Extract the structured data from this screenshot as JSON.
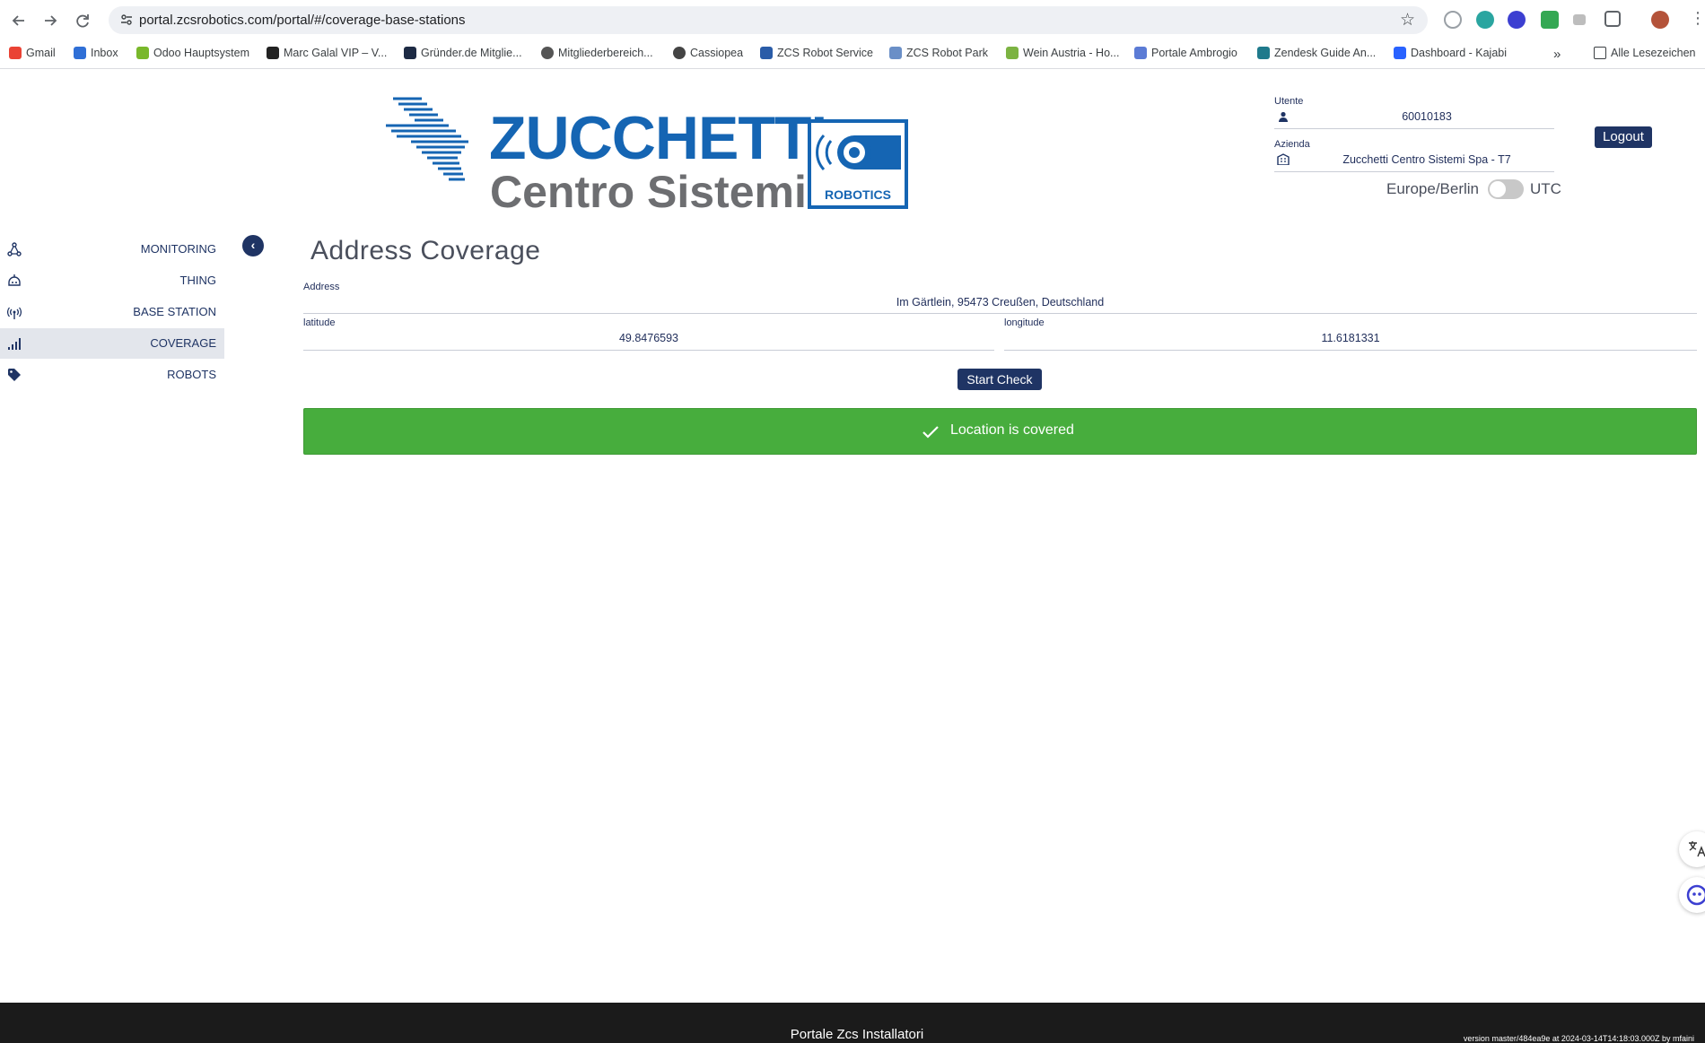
{
  "browser": {
    "url": "portal.zcsrobotics.com/portal/#/coverage-base-stations",
    "bookmarks": [
      "Gmail",
      "Inbox",
      "Odoo Hauptsystem",
      "Marc Galal VIP – V...",
      "Gründer.de Mitglie...",
      "Mitgliederbereich...",
      "Cassiopea",
      "ZCS Robot Service",
      "ZCS Robot Park",
      "Wein Austria - Ho...",
      "Portale Ambrogio",
      "Zendesk Guide An...",
      "Dashboard - Kajabi"
    ],
    "bookmarks_overflow": "»",
    "all_bookmarks": "Alle Lesezeichen"
  },
  "header": {
    "logo_main": "ZUCCHETTI",
    "logo_sub": "Centro Sistemi",
    "logo_badge": "ROBOTICS",
    "user_label": "Utente",
    "user_value": "60010183",
    "company_label": "Azienda",
    "company_value": "Zucchetti Centro Sistemi Spa - T7",
    "timezone_left": "Europe/Berlin",
    "timezone_right": "UTC",
    "logout_label": "Logout"
  },
  "sidebar": {
    "items": [
      {
        "label": "MONITORING",
        "icon": "network-icon"
      },
      {
        "label": "THING",
        "icon": "robot-icon"
      },
      {
        "label": "BASE STATION",
        "icon": "antenna-icon"
      },
      {
        "label": "COVERAGE",
        "icon": "signal-bars-icon"
      },
      {
        "label": "ROBOTS",
        "icon": "tag-icon"
      }
    ],
    "active": "COVERAGE",
    "collapse_symbol": "‹"
  },
  "main": {
    "title": "Address Coverage",
    "address_label": "Address",
    "address_value": "Im Gärtlein, 95473 Creußen, Deutschland",
    "latitude_label": "latitude",
    "latitude_value": "49.8476593",
    "longitude_label": "longitude",
    "longitude_value": "11.6181331",
    "start_button": "Start Check",
    "result_message": "Location is covered"
  },
  "footer": {
    "title": "Portale Zcs Installatori",
    "version": "version master/484ea9e at 2024-03-14T14:18:03.000Z by mfaini"
  },
  "colors": {
    "navy": "#1f3464",
    "brand_blue": "#1565b3",
    "success_green": "#47ad3d",
    "footer_bg": "#1b1b1b"
  }
}
